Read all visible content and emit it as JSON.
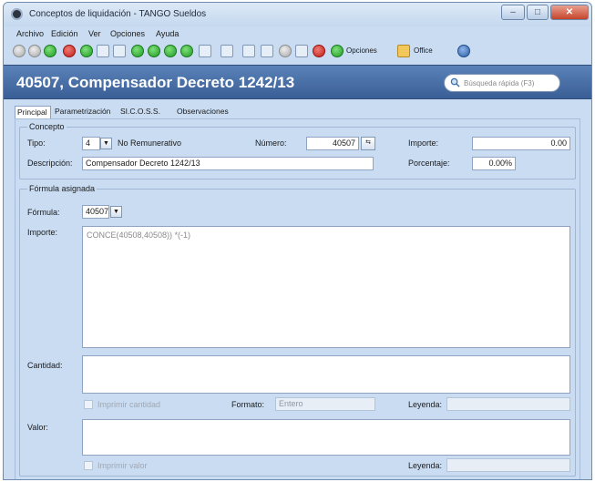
{
  "window": {
    "title": "Conceptos de liquidación - TANGO Sueldos",
    "controls": [
      "minimize-icon",
      "maximize-icon",
      "close-icon"
    ]
  },
  "menu": [
    "Archivo",
    "Edición",
    "Ver",
    "Opciones",
    "Ayuda"
  ],
  "toolbar": {
    "icons": [
      "gray-circle-icon",
      "gray-circle-icon",
      "green-plus-icon",
      "red-minus-icon",
      "green-circle-icon",
      "edit-icon",
      "refresh-icon",
      "first-record-icon",
      "previous-record-icon",
      "next-record-icon",
      "last-record-icon",
      "view-icon",
      "filter-icon",
      "grid-icon",
      "sort-icon",
      "tools-icon",
      "print-preview-icon",
      "link-icon",
      "options-icon",
      "office-icon",
      "help-icon"
    ],
    "opciones_label": "Opciones",
    "office_label": "Office"
  },
  "header": {
    "title": "40507, Compensador Decreto 1242/13",
    "search_placeholder": "Búsqueda rápida (F3)"
  },
  "tabs": [
    {
      "label": "Principal",
      "active": true
    },
    {
      "label": "Parametrización",
      "active": false
    },
    {
      "label": "SI.C.O.S.S.",
      "active": false
    },
    {
      "label": "Observaciones",
      "active": false
    }
  ],
  "concepto": {
    "group_title": "Concepto",
    "tipo_label": "Tipo:",
    "tipo_value": "4",
    "tipo_text": "No Remunerativo",
    "numero_label": "Número:",
    "numero_value": "40507",
    "importe_label": "Importe:",
    "importe_value": "0.00",
    "descripcion_label": "Descripción:",
    "descripcion_value": "Compensador Decreto 1242/13",
    "porcentaje_label": "Porcentaje:",
    "porcentaje_value": "0.00%"
  },
  "formula": {
    "group_title": "Fórmula asignada",
    "formula_label": "Fórmula:",
    "formula_value": "40507",
    "importe_label": "Importe:",
    "importe_text": "CONCE(40508,40508)) *(-1)",
    "cantidad_label": "Cantidad:",
    "imprimir_cantidad_label": "Imprimir cantidad",
    "formato_label": "Formato:",
    "formato_value": "Entero",
    "leyenda_label": "Leyenda:",
    "valor_label": "Valor:",
    "imprimir_valor_label": "Imprimir valor",
    "leyenda2_label": "Leyenda:"
  },
  "colors": {
    "header_bg": "#4a73aa",
    "panel_bg": "#c9dcf2",
    "field_border": "#8ea4c2"
  }
}
